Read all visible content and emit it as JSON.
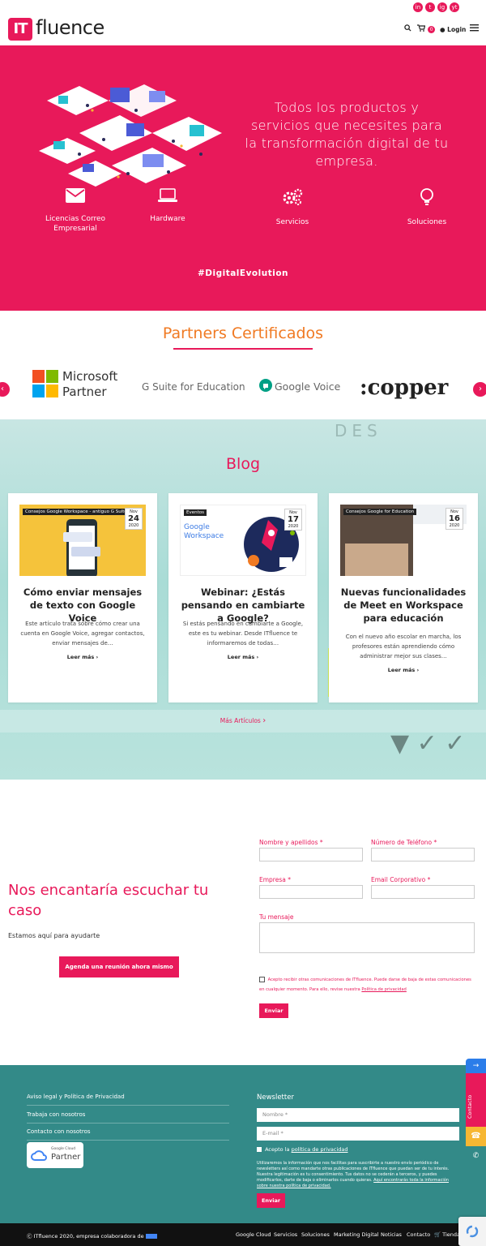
{
  "header": {
    "logo_mark": "IT",
    "logo_text": "fluence",
    "social": [
      "in",
      "t",
      "ig",
      "yt"
    ],
    "cart_count": "0",
    "login_label": "Login"
  },
  "hero": {
    "title": "Todos los productos y servicios que necesites para la transformación digital de tu empresa.",
    "features": [
      {
        "label": "Licencias Correo Empresarial",
        "icon": "envelope-icon"
      },
      {
        "label": "Hardware",
        "icon": "laptop-icon"
      },
      {
        "label": "Servicios",
        "icon": "gears-icon"
      },
      {
        "label": "Soluciones",
        "icon": "lightbulb-icon"
      }
    ],
    "hashtag": "#DigitalEvolution"
  },
  "partners": {
    "title": "Partners Certificados",
    "logos": {
      "microsoft_line1": "Microsoft",
      "microsoft_line2": "Partner",
      "gsuite": "G Suite for Education",
      "gvoice": "Google Voice",
      "copper": ":copper"
    }
  },
  "blog": {
    "title": "Blog",
    "posts": [
      {
        "category": "Consejos Google Workspace - antiguo G Suite",
        "month": "Nov",
        "day": "24",
        "year": "2020",
        "title": "Cómo enviar mensajes de texto con Google Voice",
        "excerpt": "Este artículo trata sobre cómo crear una cuenta en Google Voice, agregar contactos, enviar mensajes de…",
        "more": "Leer más"
      },
      {
        "category": "Eventos",
        "month": "Nov",
        "day": "17",
        "year": "2020",
        "img_title": "Google Workspace",
        "title": "Webinar: ¿Estás pensando en cambiarte a Google?",
        "excerpt": "Si estás pensando en cambiarte a Google, este es tu webinar. Desde ITfluence te informaremos de todas…",
        "more": "Leer más"
      },
      {
        "category": "Consejos Google for Education",
        "month": "Nov",
        "day": "16",
        "year": "2020",
        "title": "Nuevas funcionalidades de Meet en Workspace para educación",
        "excerpt": "Con el nuevo año escolar en marcha, los profesores están aprendiendo cómo administrar mejor sus clases…",
        "more": "Leer más"
      }
    ],
    "more_link": "Más Artículos"
  },
  "contact": {
    "title": "Nos encantaría escuchar tu caso",
    "subtitle": "Estamos aquí para ayudarte",
    "meeting_button": "Agenda una reunión ahora mismo",
    "fields": {
      "name": "Nombre y apellidos *",
      "phone": "Número de Teléfono *",
      "company": "Empresa *",
      "email": "Email Corporativo *",
      "message": "Tu mensaje"
    },
    "consent_text": "Acepto recibir otras comunicaciones de ITfluence. Puede darse de baja de estas comunicaciones en cualquier momento. Para ello, revise nuestra",
    "consent_link": "Política de privacidad",
    "send_button": "Enviar"
  },
  "footer": {
    "links": [
      "Aviso legal y Política de Privacidad",
      "Trabaja con nosotros",
      "Contacto con nosotros"
    ],
    "badge_top": "Google Cloud",
    "badge_main": "Partner",
    "newsletter": {
      "title": "Newsletter",
      "name_placeholder": "Nombre *",
      "email_placeholder": "E-mail *",
      "consent_prefix": "Acepto la",
      "consent_link": "política de privacidad",
      "legal_text": "Utilizaremos la información que nos facilitas para suscribirte a nuestro envío periódico de newsletters así como mandarte otras publicaciones de ITfluence que puedan ser de tu interés. Nuestra legitimación es tu consentimiento. Tus datos no se cederán a terceros, y puedes modificarlos, darte de baja o eliminarlos cuando quieras.",
      "legal_link": "Aquí encontrarás toda la información sobre nuestra política de privacidad.",
      "button": "Enviar"
    }
  },
  "side": {
    "contact_label": "Contacto"
  },
  "bottom_bar": {
    "copyright": "ITfluence 2020, empresa colaboradora de",
    "links": [
      "Google Cloud",
      "Servicios",
      "Soluciones",
      "Marketing Digital",
      "Noticias",
      "Contacto",
      "Tienda"
    ]
  },
  "colors": {
    "brand_pink": "#e8195a",
    "accent_orange": "#f07a23",
    "footer_teal": "#338a88"
  }
}
